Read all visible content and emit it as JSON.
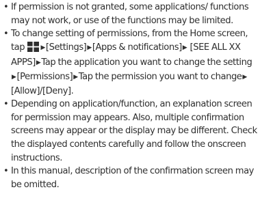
{
  "bullet_char": "•",
  "notes": [
    {
      "text": "If permission is not granted, some applications/ functions may not work, or use of the functions may be limited."
    },
    {
      "intro": "To change setting of permissions, from the Home screen, tap",
      "icon": "home-apps-icon",
      "arrow_char": "▶",
      "steps": [
        "[Settings]",
        "[Apps & notifications]",
        "[SEE ALL XX APPS]",
        "Tap the application you want to change the setting",
        "[Permissions]",
        "Tap the permission you want to change",
        "[Allow]/[Deny]."
      ]
    },
    {
      "text": "Depending on application/function, an explanation screen for permission may appears. Also, multiple confirmation screens may appear or the display may be different. Check the displayed contents carefully and follow the onscreen instructions."
    },
    {
      "text": "In this manual, description of the confirmation screen may be omitted."
    }
  ],
  "colors": {
    "text": "#2e2e2e",
    "icon": "#2e2e2e"
  }
}
